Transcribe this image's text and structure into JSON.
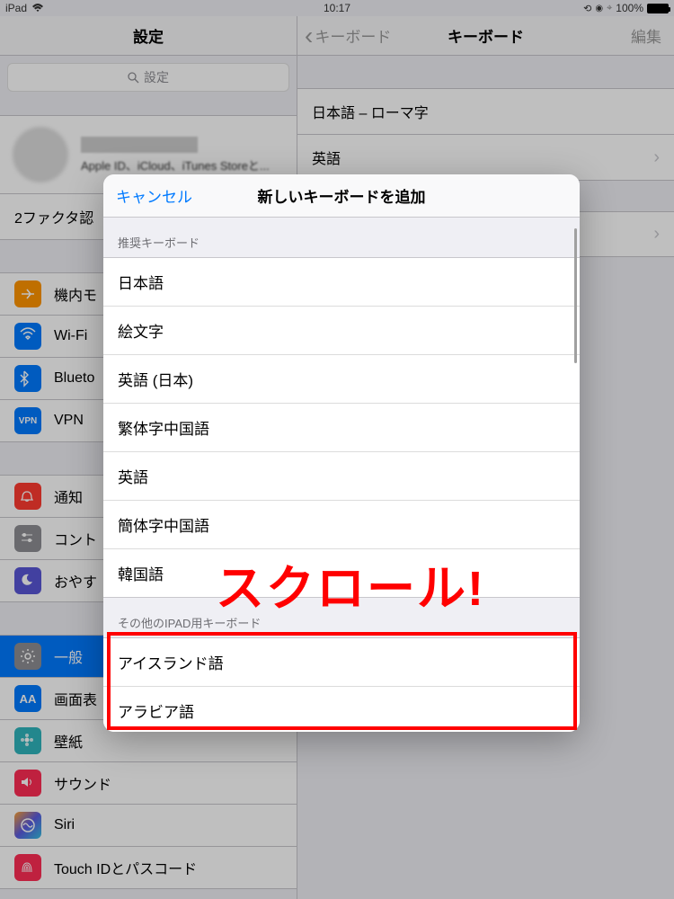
{
  "status": {
    "device": "iPad",
    "wifi_icon": "wifi",
    "time": "10:17",
    "orientation_icon": "⊕",
    "alarm_icon": "⏰",
    "bt_icon": "✻",
    "battery_pct": "100%"
  },
  "left": {
    "title": "設定",
    "search_placeholder": "設定",
    "apple_id_sub": "Apple ID、iCloud、iTunes Storeと...",
    "two_factor": "2ファクタ認",
    "items": [
      {
        "label": "機内モ",
        "icon": "airplane",
        "color": "i-orange"
      },
      {
        "label": "Wi-Fi",
        "icon": "wifi",
        "color": "i-blue"
      },
      {
        "label": "Blueto",
        "icon": "bluetooth",
        "color": "i-blue"
      },
      {
        "label": "VPN",
        "icon": "vpn",
        "color": "i-blue"
      }
    ],
    "items2": [
      {
        "label": "通知",
        "icon": "bell",
        "color": "i-red"
      },
      {
        "label": "コント",
        "icon": "sliders",
        "color": "i-grey"
      },
      {
        "label": "おやす",
        "icon": "moon",
        "color": "i-purple"
      }
    ],
    "items3": [
      {
        "label": "一般",
        "icon": "gear",
        "color": "i-grey",
        "selected": true
      },
      {
        "label": "画面表",
        "icon": "aA",
        "color": "i-blue"
      },
      {
        "label": "壁紙",
        "icon": "flower",
        "color": "i-cyan"
      },
      {
        "label": "サウンド",
        "icon": "speaker",
        "color": "i-redp"
      },
      {
        "label": "Siri",
        "icon": "siri",
        "color": "i-grad"
      },
      {
        "label": "Touch IDとパスコード",
        "icon": "finger",
        "color": "i-redp"
      }
    ]
  },
  "right": {
    "back": "キーボード",
    "title": "キーボード",
    "edit": "編集",
    "keyboards": [
      "日本語 – ローマ字",
      "英語"
    ]
  },
  "modal": {
    "cancel": "キャンセル",
    "title": "新しいキーボードを追加",
    "section1": "推奨キーボード",
    "recommended": [
      "日本語",
      "絵文字",
      "英語 (日本)",
      "繁体字中国語",
      "英語",
      "簡体字中国語",
      "韓国語"
    ],
    "section2": "その他のIPAD用キーボード",
    "others": [
      "アイスランド語",
      "アラビア語"
    ]
  },
  "annotation": "スクロール!"
}
